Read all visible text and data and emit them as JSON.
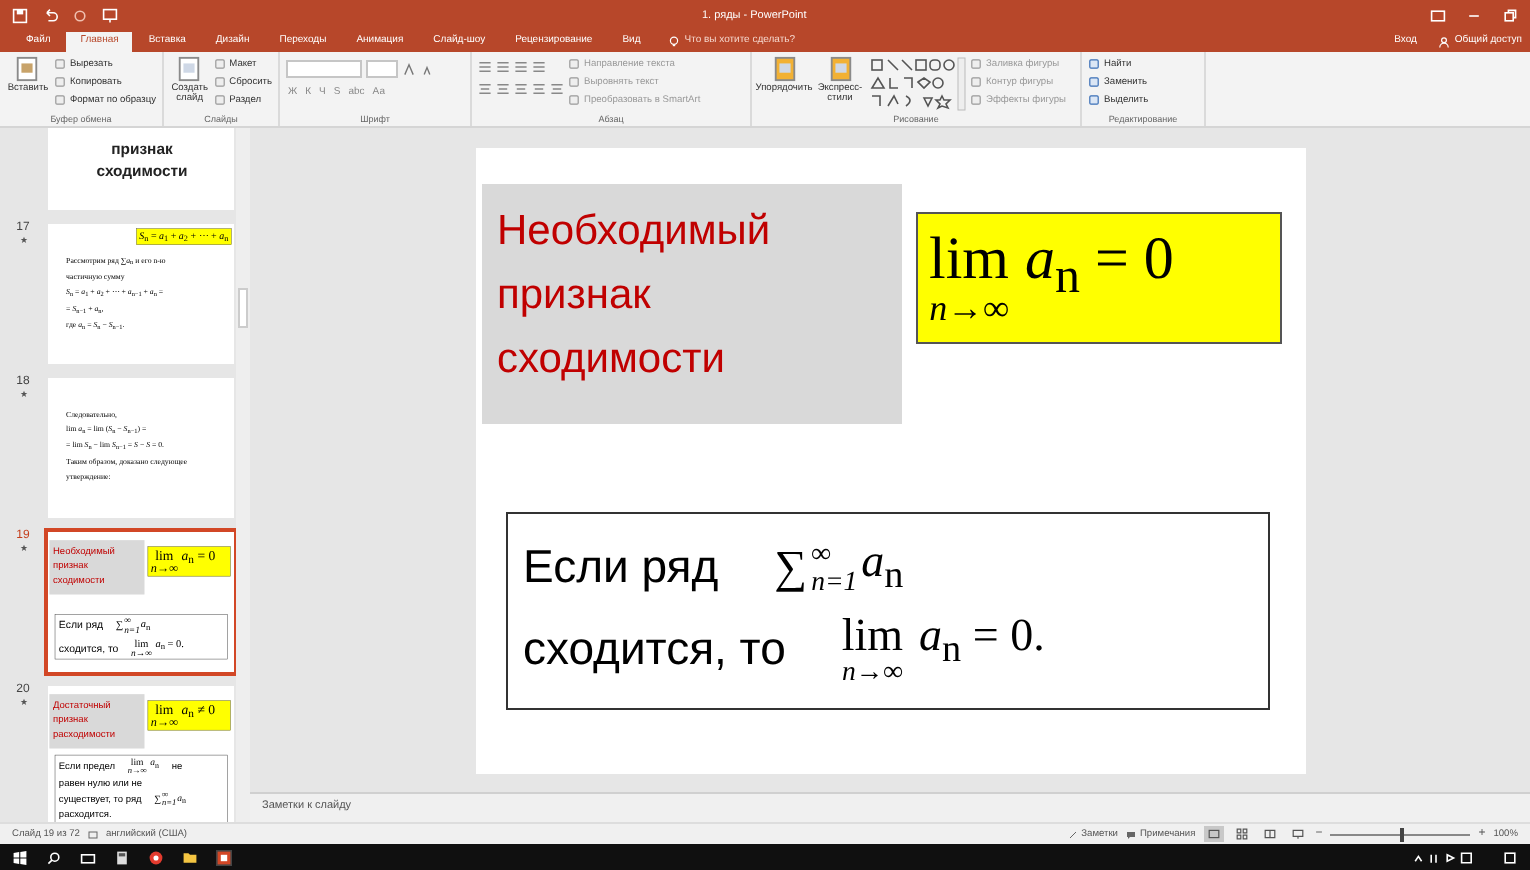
{
  "window": {
    "title": "1. ряды - PowerPoint"
  },
  "tabs": [
    {
      "label": "Файл",
      "selected": false
    },
    {
      "label": "Главная",
      "selected": true
    },
    {
      "label": "Вставка",
      "selected": false
    },
    {
      "label": "Дизайн",
      "selected": false
    },
    {
      "label": "Переходы",
      "selected": false
    },
    {
      "label": "Анимация",
      "selected": false
    },
    {
      "label": "Слайд-шоу",
      "selected": false
    },
    {
      "label": "Рецензирование",
      "selected": false
    },
    {
      "label": "Вид",
      "selected": false
    }
  ],
  "tell_me": "Что вы хотите сделать?",
  "account": {
    "sign_in": "Вход",
    "share": "Общий доступ"
  },
  "ribbon": [
    {
      "label": "Буфер обмена",
      "kind": "clipboard",
      "big": [
        "Вставить"
      ],
      "items": [
        "Вырезать",
        "Копировать",
        "Формат по образцу"
      ]
    },
    {
      "label": "Слайды",
      "kind": "slides",
      "big": [
        "Создать слайд"
      ],
      "items": [
        "Макет",
        "Сбросить",
        "Раздел"
      ]
    },
    {
      "label": "Шрифт",
      "kind": "font",
      "buttons": [
        "Ж",
        "К",
        "Ч",
        "S",
        "abc",
        "Аа"
      ]
    },
    {
      "label": "Абзац",
      "kind": "paragraph",
      "items": [
        "Направление текста",
        "Выровнять текст",
        "Преобразовать в SmartArt"
      ]
    },
    {
      "label": "Рисование",
      "kind": "drawing",
      "big": [
        "Упорядочить",
        "Экспресс-стили"
      ],
      "items": [
        "Заливка фигуры",
        "Контур фигуры",
        "Эффекты фигуры"
      ]
    },
    {
      "label": "Редактирование",
      "kind": "editing",
      "items": [
        "Найти",
        "Заменить",
        "Выделить"
      ]
    }
  ],
  "thumbnails": [
    {
      "selected": false,
      "slide": {
        "kind": "title",
        "title": "признак сходимости"
      }
    },
    {
      "number": "17",
      "selected": false,
      "slide": {
        "kind": "text",
        "formula": [
          {
            "kind": "text",
            "text": "*S*$_{n}$ = *a*$_{1}$ + *a*$_{2}$ + ⋯ + *a*$_{n}$"
          }
        ],
        "lines": [
          "Рассмотрим ряд ∑*a*$_{n}$ и его n-ю",
          "частичную сумму",
          "*S*$_{n}$ = *a*$_{1}$ + *a*$_{2}$ + ⋯ + *a*$_{n−1}$ + *a*$_{n}$ =",
          "= *S*$_{n−1}$ + *a*$_{n}$,",
          "где *a*$_{n}$ = *S*$_{n}$ − *S*$_{n−1}$."
        ]
      }
    },
    {
      "number": "18",
      "selected": false,
      "slide": {
        "kind": "text",
        "lines": [
          "Следовательно,",
          "lim *a*$_{n}$ = lim (*S*$_{n}$ − *S*$_{n−1}$) =",
          "= lim *S*$_{n}$ − lim *S*$_{n−1}$ = *S* − *S* = 0.",
          "Таким образом, доказано следующее",
          "утверждение:"
        ]
      }
    },
    {
      "number": "19",
      "selected": true,
      "slide": {
        "kind": "theorem",
        "title": "Необходимый признак сходимости",
        "formula": [
          {
            "kind": "limit",
            "op": "lim",
            "under": "n→∞",
            "expr": "*a*$_{n}$ = 0"
          }
        ],
        "lines": [
          [
            {
              "kind": "text",
              "text": "Если ряд"
            },
            {
              "kind": "sum",
              "op": "∑",
              "upper": "∞",
              "lower": "n=1",
              "expr": "*a*$_{n}$"
            }
          ],
          [
            {
              "kind": "text",
              "text": "сходится, то"
            },
            {
              "kind": "limit",
              "op": "lim",
              "under": "n→∞",
              "expr": "*a*$_{n}$ = 0."
            }
          ]
        ]
      }
    },
    {
      "number": "20",
      "selected": false,
      "slide": {
        "kind": "theorem",
        "title": "Достаточный признак расходимости",
        "formula": [
          {
            "kind": "limit",
            "op": "lim",
            "under": "n→∞",
            "expr": "*a*$_{n}$ ≠ 0"
          }
        ],
        "lines": [
          [
            {
              "kind": "text",
              "text": "Если предел"
            },
            {
              "kind": "limit",
              "op": "lim",
              "under": "n→∞",
              "expr": "*a*$_{n}$"
            },
            {
              "kind": "text",
              "text": "не"
            }
          ],
          [
            {
              "kind": "text",
              "text": "равен нулю или не"
            }
          ],
          [
            {
              "kind": "text",
              "text": "существует, то ряд"
            },
            {
              "kind": "sum",
              "op": "∑",
              "upper": "∞",
              "lower": "n=1",
              "expr": "*a*$_{n}$"
            }
          ],
          [
            {
              "kind": "text",
              "text": "расходится."
            }
          ]
        ]
      }
    }
  ],
  "slide": {
    "kind": "theorem",
    "title": "Необходимый признак сходимости",
    "formula": [
      {
        "kind": "limit",
        "op": "lim",
        "under": "n→∞",
        "expr": "*a*$_{n}$ = 0"
      }
    ],
    "lines": [
      [
        {
          "kind": "text",
          "text": "Если ряд"
        },
        {
          "kind": "sum",
          "op": "∑",
          "upper": "∞",
          "lower": "n=1",
          "expr": "*a*$_{n}$"
        }
      ],
      [
        {
          "kind": "text",
          "text": "сходится, то"
        },
        {
          "kind": "limit",
          "op": "lim",
          "under": "n→∞",
          "expr": "*a*$_{n}$ = 0."
        }
      ]
    ]
  },
  "notes_placeholder": "Заметки к слайду",
  "status_bar": {
    "slide": "Слайд 19 из 72",
    "language": "английский (США)",
    "notes": "Заметки",
    "comments": "Примечания",
    "views": [
      {
        "kind": "normal",
        "selected": true
      },
      {
        "kind": "sorter",
        "selected": false
      },
      {
        "kind": "reading",
        "selected": false
      },
      {
        "kind": "show",
        "selected": false
      }
    ],
    "zoom": {
      "out": "−",
      "in": "+",
      "level": 0.5,
      "reading": "100%"
    }
  }
}
